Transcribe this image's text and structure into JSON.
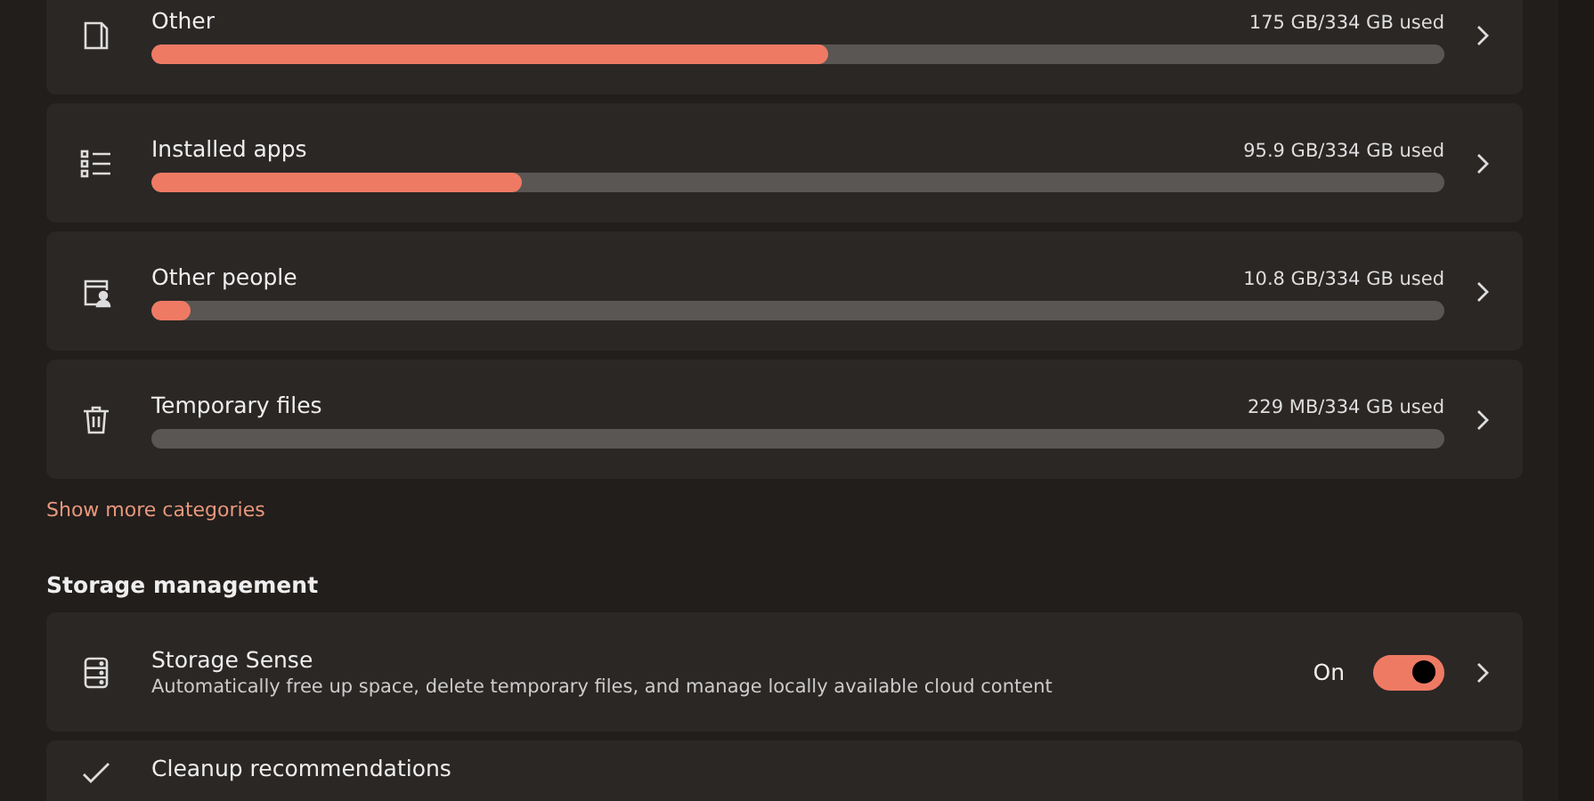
{
  "categories": [
    {
      "kind": "other",
      "label": "Other",
      "usage": "175 GB/334 GB used",
      "level": 0.523
    },
    {
      "kind": "apps",
      "label": "Installed apps",
      "usage": "95.9 GB/334 GB used",
      "level": 0.286
    },
    {
      "kind": "people",
      "label": "Other people",
      "usage": "10.8 GB/334 GB used",
      "level": 0.03
    },
    {
      "kind": "temp",
      "label": "Temporary files",
      "usage": "229 MB/334 GB used"
    }
  ],
  "show_more_link": "Show more categories",
  "storage_management": {
    "heading": "Storage management",
    "items": [
      {
        "kind": "sense",
        "title": "Storage Sense",
        "description": "Automatically free up space, delete temporary files, and manage locally available cloud content",
        "toggle": {
          "label": "On",
          "on": true
        }
      },
      {
        "kind": "cleanup",
        "title": "Cleanup recommendations"
      }
    ]
  }
}
